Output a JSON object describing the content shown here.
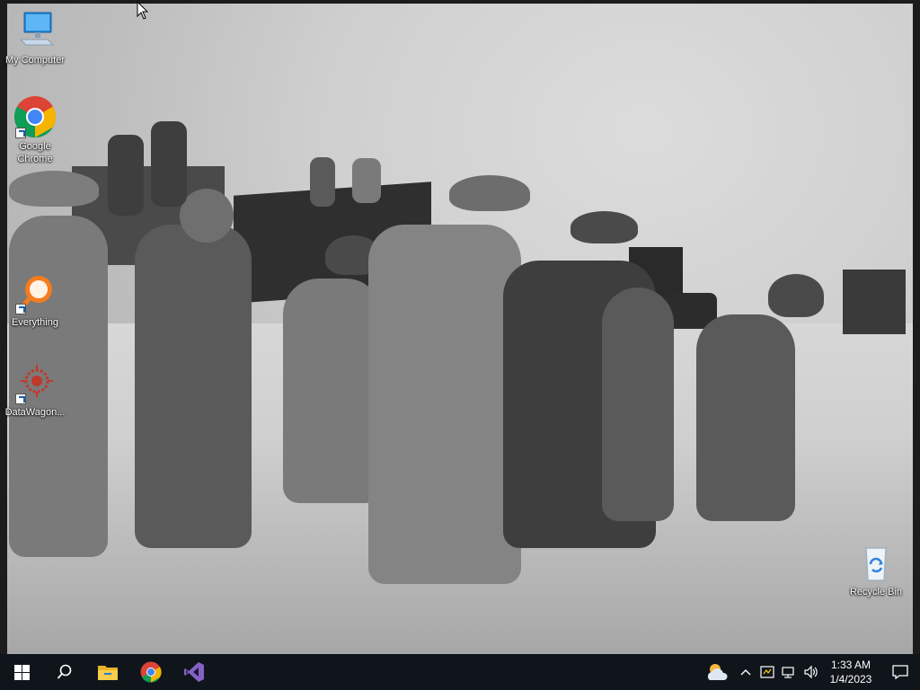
{
  "desktop": {
    "icons": [
      {
        "name": "my-computer",
        "label": "My Computer"
      },
      {
        "name": "google-chrome",
        "label": "Google Chrome"
      },
      {
        "name": "everything",
        "label": "Everything"
      },
      {
        "name": "datawagon",
        "label": "DataWagon..."
      },
      {
        "name": "recycle-bin",
        "label": "Recycle Bin"
      }
    ]
  },
  "taskbar": {
    "pinned": [
      {
        "name": "start",
        "icon": "windows-logo-icon"
      },
      {
        "name": "search",
        "icon": "search-icon"
      },
      {
        "name": "file-explorer",
        "icon": "folder-icon"
      },
      {
        "name": "chrome",
        "icon": "chrome-icon"
      },
      {
        "name": "visual-studio",
        "icon": "visual-studio-icon"
      }
    ],
    "tray": {
      "weather_icon": "weather-partly-cloudy-icon",
      "time": "1:33 AM",
      "date": "1/4/2023"
    }
  },
  "colors": {
    "taskbar_bg": "#10141b",
    "accent": "#1a73e8"
  }
}
